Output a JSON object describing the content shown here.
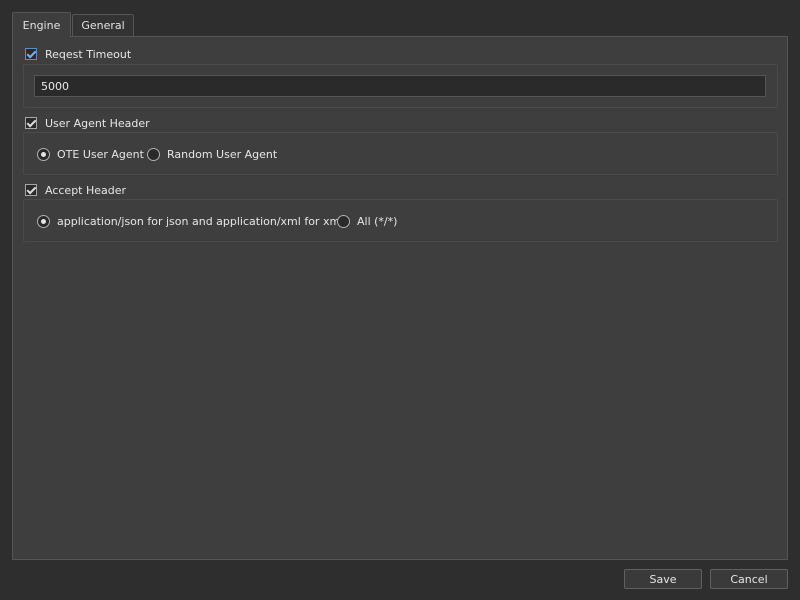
{
  "tabs": [
    {
      "label": "Engine",
      "active": true
    },
    {
      "label": "General",
      "active": false
    }
  ],
  "request_timeout": {
    "label": "Reqest Timeout",
    "checked": true,
    "value": "5000"
  },
  "user_agent": {
    "label": "User Agent Header",
    "checked": true,
    "options": [
      {
        "label": "OTE User Agent",
        "selected": true
      },
      {
        "label": "Random User Agent",
        "selected": false
      }
    ]
  },
  "accept_header": {
    "label": "Accept Header",
    "checked": true,
    "options": [
      {
        "label": "application/json for json and application/xml for xml",
        "selected": true
      },
      {
        "label": "All (*/*)",
        "selected": false
      }
    ]
  },
  "footer": {
    "save_label": "Save",
    "cancel_label": "Cancel"
  },
  "colors": {
    "background": "#2e2e2e",
    "panel": "#3e3e3e",
    "accent": "#5a8fc7"
  }
}
